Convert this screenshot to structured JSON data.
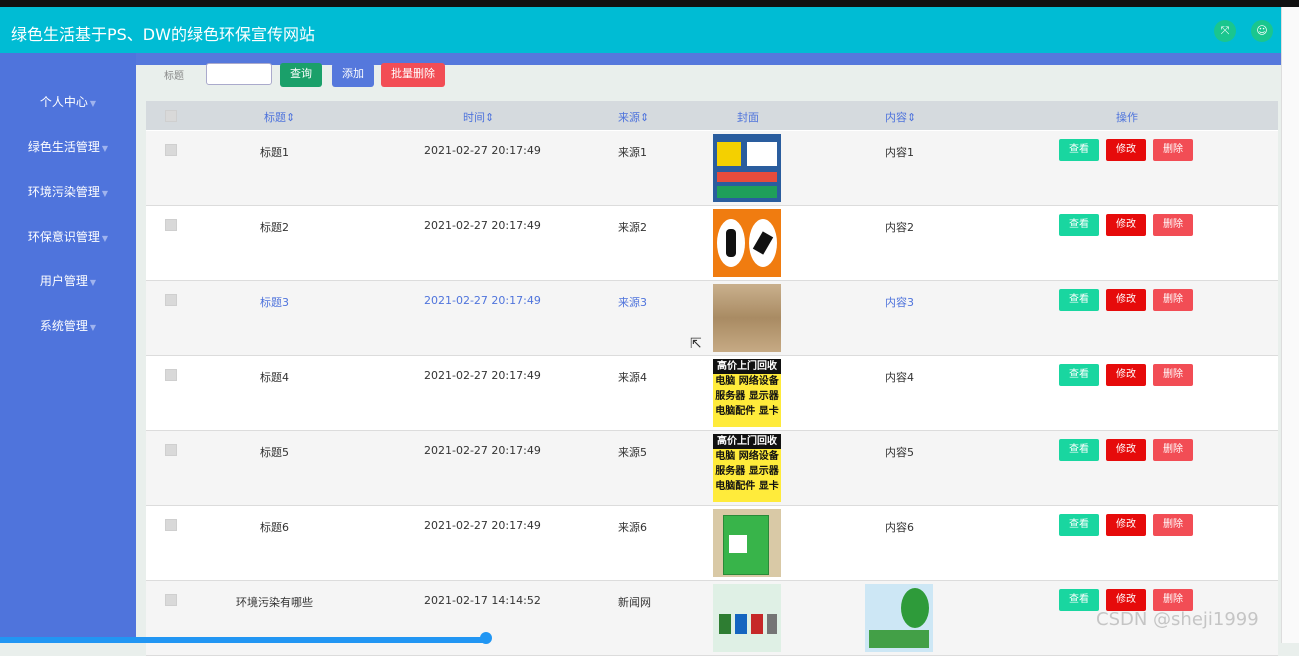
{
  "app": {
    "title": "绿色生活基于PS、DW的绿色环保宣传网站"
  },
  "header_icons": [
    "expand-icon",
    "user-icon"
  ],
  "sidebar": {
    "items": [
      {
        "label": "个人中心"
      },
      {
        "label": "绿色生活管理"
      },
      {
        "label": "环境污染管理"
      },
      {
        "label": "环保意识管理"
      },
      {
        "label": "用户管理"
      },
      {
        "label": "系统管理"
      }
    ]
  },
  "toolbar": {
    "search_label": "标题",
    "search_value": "",
    "query_label": "查询",
    "add_label": "添加",
    "batch_delete_label": "批量删除"
  },
  "table": {
    "columns": {
      "title": "标题",
      "time": "时间",
      "source": "来源",
      "cover": "封面",
      "content": "内容",
      "actions": "操作"
    },
    "rows": [
      {
        "title": "标题1",
        "time": "2021-02-27 20:17:49",
        "source": "来源1",
        "content": "内容1",
        "cover": "poster"
      },
      {
        "title": "标题2",
        "time": "2021-02-27 20:17:49",
        "source": "来源2",
        "content": "内容2",
        "cover": "orange-sign"
      },
      {
        "title": "标题3",
        "time": "2021-02-27 20:17:49",
        "source": "来源3",
        "content": "内容3",
        "cover": "cardboard"
      },
      {
        "title": "标题4",
        "time": "2021-02-27 20:17:49",
        "source": "来源4",
        "content": "内容4",
        "cover": "ad"
      },
      {
        "title": "标题5",
        "time": "2021-02-27 20:17:49",
        "source": "来源5",
        "content": "内容5",
        "cover": "ad"
      },
      {
        "title": "标题6",
        "time": "2021-02-27 20:17:49",
        "source": "来源6",
        "content": "内容6",
        "cover": "bin"
      },
      {
        "title": "环境污染有哪些",
        "time": "2021-02-17 14:14:52",
        "source": "新闻网",
        "content": "",
        "cover": "poster2"
      }
    ],
    "actions": {
      "view": "查看",
      "edit": "修改",
      "delete": "删除"
    }
  },
  "ad_text": {
    "line1": "高价上门回收",
    "line2": "电脑 网络设备",
    "line3": "服务器 显示器",
    "line4": "电脑配件 显卡"
  },
  "watermark": "CSDN @sheji1999",
  "colors": {
    "header": "#00bcd4",
    "sidebar": "#4f74dc",
    "view": "#19d6a0",
    "edit": "#e60b0b",
    "delete": "#f24d55"
  }
}
